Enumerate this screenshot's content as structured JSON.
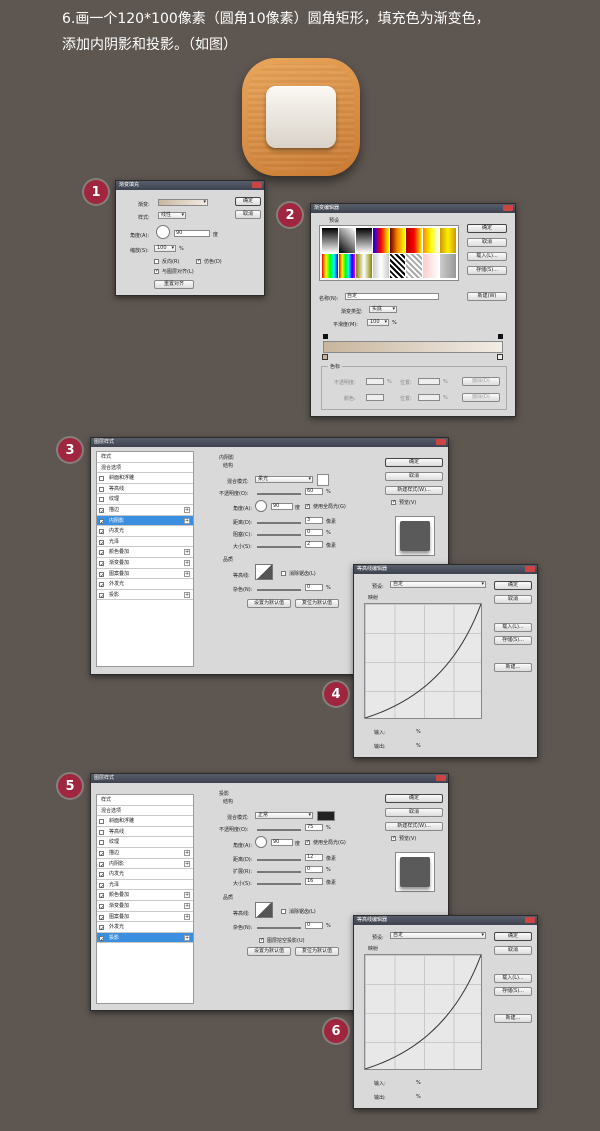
{
  "header": {
    "line1": "6.画一个120*100像素（圆角10像素）圆角矩形，填充色为渐变色，",
    "line2": "添加内阴影和投影。（如图）"
  },
  "steps": [
    "1",
    "2",
    "3",
    "4",
    "5",
    "6"
  ],
  "gradient_fill": {
    "title": "渐变填充",
    "gradient_label": "渐变:",
    "style_label": "样式:",
    "style_value": "线性",
    "angle_label": "角度(A):",
    "angle_value": "90",
    "angle_unit": "度",
    "scale_label": "缩放(S):",
    "scale_value": "100",
    "scale_unit": "%",
    "reverse_label": "反向(R)",
    "dither_label": "仿色(D)",
    "align_label": "与图层对齐(L)",
    "reset_button": "重置对齐",
    "ok": "确定",
    "cancel": "取消"
  },
  "gradient_editor": {
    "title": "渐变编辑器",
    "presets_label": "预设",
    "name_label": "名称(N):",
    "name_value": "自定",
    "new_button": "新建(W)",
    "type_label": "渐变类型:",
    "type_value": "实底",
    "smooth_label": "平滑度(M):",
    "smooth_value": "100",
    "smooth_unit": "%",
    "stops_label": "色标",
    "opacity_label": "不透明度:",
    "location_label": "位置:",
    "delete_button": "删除(D)",
    "color_label": "颜色:",
    "percent": "%",
    "ok": "确定",
    "cancel": "取消",
    "load": "载入(L)...",
    "save": "存储(S)..."
  },
  "layer_style_inner": {
    "title": "图层样式",
    "section_title": "内阴影",
    "structure_label": "结构",
    "blend_label": "混合模式:",
    "blend_value": "柔光",
    "opacity_label": "不透明度(O):",
    "opacity_value": "60",
    "angle_label": "角度(A):",
    "angle_value": "90",
    "global_light": "使用全局光(G)",
    "distance_label": "距离(D):",
    "distance_value": "3",
    "choke_label": "阻塞(C):",
    "choke_value": "0",
    "size_label": "大小(S):",
    "size_value": "2",
    "px": "像素",
    "percent": "%",
    "degree": "度",
    "quality_label": "品质",
    "contour_label": "等高线:",
    "antialias_label": "消除锯齿(L)",
    "noise_label": "杂色(N):",
    "noise_value": "0",
    "default_btn": "设置为默认值",
    "reset_btn": "复位为默认值",
    "ok": "确定",
    "cancel": "取消",
    "new_style": "新建样式(W)...",
    "preview": "预览(V)",
    "list": [
      {
        "label": "样式",
        "check": false,
        "plus": false,
        "selected": false
      },
      {
        "label": "混合选项",
        "check": false,
        "plus": false,
        "selected": false
      },
      {
        "label": "斜面和浮雕",
        "check": true,
        "plus": false,
        "selected": false
      },
      {
        "label": "等高线",
        "check": true,
        "plus": false,
        "selected": false
      },
      {
        "label": "纹理",
        "check": true,
        "plus": false,
        "selected": false
      },
      {
        "label": "描边",
        "check": true,
        "plus": true,
        "selected": false
      },
      {
        "label": "内阴影",
        "check": true,
        "plus": true,
        "selected": true
      },
      {
        "label": "内发光",
        "check": true,
        "plus": false,
        "selected": false
      },
      {
        "label": "光泽",
        "check": true,
        "plus": false,
        "selected": false
      },
      {
        "label": "颜色叠加",
        "check": true,
        "plus": true,
        "selected": false
      },
      {
        "label": "渐变叠加",
        "check": true,
        "plus": true,
        "selected": false
      },
      {
        "label": "图案叠加",
        "check": true,
        "plus": true,
        "selected": false
      },
      {
        "label": "外发光",
        "check": true,
        "plus": false,
        "selected": false
      },
      {
        "label": "投影",
        "check": true,
        "plus": true,
        "selected": false
      }
    ]
  },
  "layer_style_drop": {
    "title": "图层样式",
    "section_title": "投影",
    "structure_label": "结构",
    "blend_label": "混合模式:",
    "blend_value": "正常",
    "opacity_label": "不透明度(O):",
    "opacity_value": "75",
    "angle_label": "角度(A):",
    "angle_value": "90",
    "global_light": "使用全局光(G)",
    "distance_label": "距离(D):",
    "distance_value": "12",
    "spread_label": "扩展(R):",
    "spread_value": "0",
    "size_label": "大小(S):",
    "size_value": "16",
    "px": "像素",
    "percent": "%",
    "degree": "度",
    "quality_label": "品质",
    "contour_label": "等高线:",
    "antialias_label": "消除锯齿(L)",
    "noise_label": "杂色(N):",
    "noise_value": "0",
    "knockout": "图层挖空投影(U)",
    "default_btn": "设置为默认值",
    "reset_btn": "复位为默认值",
    "ok": "确定",
    "cancel": "取消",
    "new_style": "新建样式(W)...",
    "preview": "预览(V)",
    "list": [
      {
        "label": "样式",
        "check": false,
        "plus": false,
        "selected": false
      },
      {
        "label": "混合选项",
        "check": false,
        "plus": false,
        "selected": false
      },
      {
        "label": "斜面和浮雕",
        "check": true,
        "plus": false,
        "selected": false
      },
      {
        "label": "等高线",
        "check": true,
        "plus": false,
        "selected": false
      },
      {
        "label": "纹理",
        "check": true,
        "plus": false,
        "selected": false
      },
      {
        "label": "描边",
        "check": true,
        "plus": true,
        "selected": false
      },
      {
        "label": "内阴影",
        "check": true,
        "plus": true,
        "selected": false
      },
      {
        "label": "内发光",
        "check": true,
        "plus": false,
        "selected": false
      },
      {
        "label": "光泽",
        "check": true,
        "plus": false,
        "selected": false
      },
      {
        "label": "颜色叠加",
        "check": true,
        "plus": true,
        "selected": false
      },
      {
        "label": "渐变叠加",
        "check": true,
        "plus": true,
        "selected": false
      },
      {
        "label": "图案叠加",
        "check": true,
        "plus": true,
        "selected": false
      },
      {
        "label": "外发光",
        "check": true,
        "plus": false,
        "selected": false
      },
      {
        "label": "投影",
        "check": true,
        "plus": true,
        "selected": true
      }
    ]
  },
  "contour_editor": {
    "title": "等高线编辑器",
    "preset_label": "预设:",
    "preset_value": "自定",
    "map_label": "映射",
    "input_label": "输入:",
    "output_label": "输出:",
    "percent": "%",
    "ok": "确定",
    "cancel": "取消",
    "load": "载入(L)...",
    "save": "存储(S)...",
    "new": "新建..."
  }
}
